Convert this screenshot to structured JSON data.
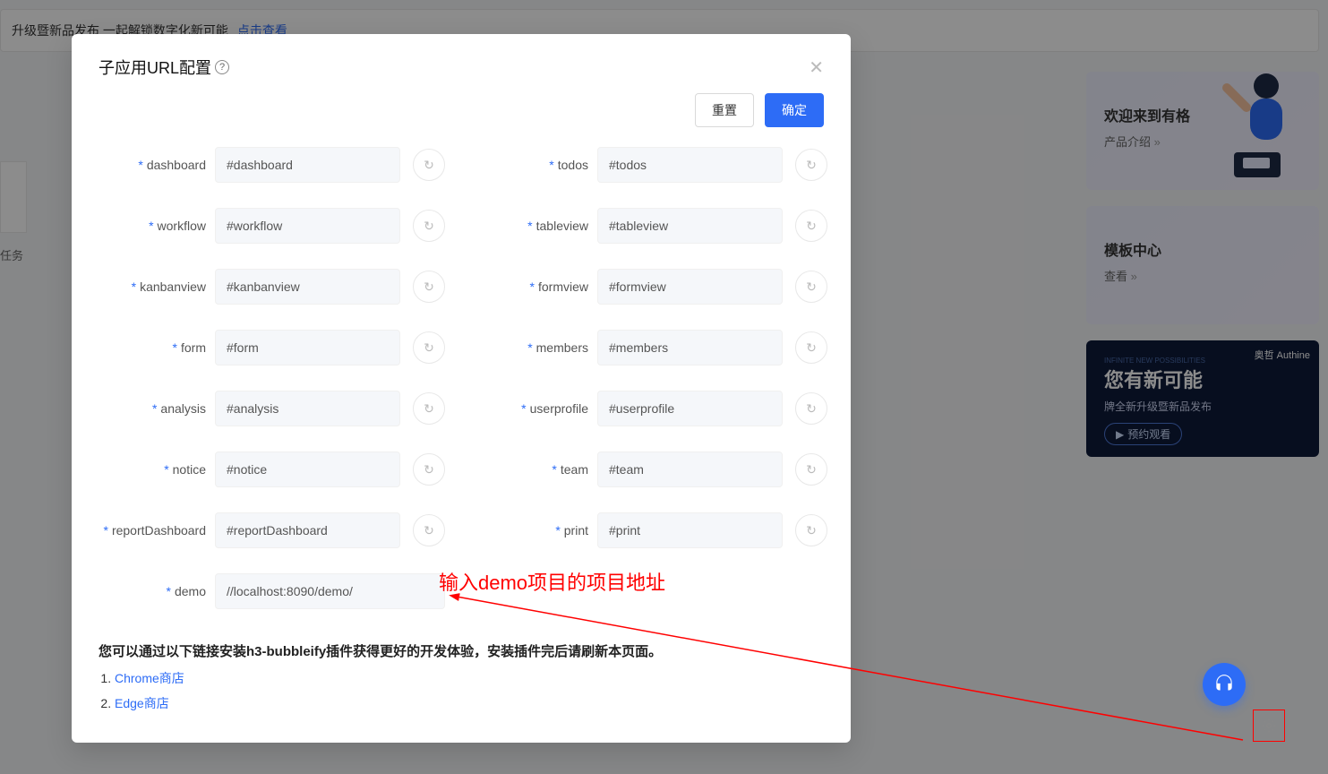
{
  "banner": {
    "text": "升级暨新品发布 一起解锁数字化新可能",
    "link": "点击查看"
  },
  "sidebar": {
    "task_label": "任务"
  },
  "promo1": {
    "title": "欢迎来到有格",
    "sub": "产品介绍"
  },
  "promo2": {
    "title": "模板中心",
    "sub": "查看"
  },
  "dark": {
    "brand": "奥哲 Authine",
    "tagline": "INFINITE NEW POSSIBILITIES",
    "big": "您有新可能",
    "small": "牌全新升级暨新品发布",
    "btn": "预约观看"
  },
  "modal": {
    "title": "子应用URL配置",
    "reset": "重置",
    "confirm": "确定",
    "rows": {
      "l0": {
        "label": "dashboard",
        "value": "#dashboard"
      },
      "r0": {
        "label": "todos",
        "value": "#todos"
      },
      "l1": {
        "label": "workflow",
        "value": "#workflow"
      },
      "r1": {
        "label": "tableview",
        "value": "#tableview"
      },
      "l2": {
        "label": "kanbanview",
        "value": "#kanbanview"
      },
      "r2": {
        "label": "formview",
        "value": "#formview"
      },
      "l3": {
        "label": "form",
        "value": "#form"
      },
      "r3": {
        "label": "members",
        "value": "#members"
      },
      "l4": {
        "label": "analysis",
        "value": "#analysis"
      },
      "r4": {
        "label": "userprofile",
        "value": "#userprofile"
      },
      "l5": {
        "label": "notice",
        "value": "#notice"
      },
      "r5": {
        "label": "team",
        "value": "#team"
      },
      "l6": {
        "label": "reportDashboard",
        "value": "#reportDashboard"
      },
      "r6": {
        "label": "print",
        "value": "#print"
      },
      "l7": {
        "label": "demo",
        "value": "//localhost:8090/demo/"
      }
    },
    "annotation": "输入demo项目的项目地址",
    "footer_text": "您可以通过以下链接安装h3-bubbleify插件获得更好的开发体验，安装插件完后请刷新本页面。",
    "links": {
      "chrome": "Chrome商店",
      "edge": "Edge商店"
    }
  }
}
